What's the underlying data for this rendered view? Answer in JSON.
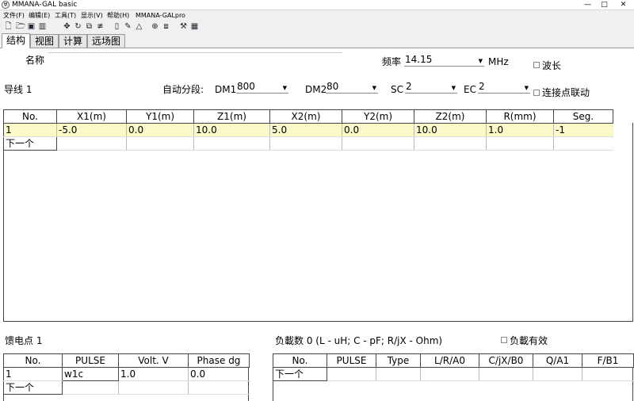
{
  "window": {
    "title": "MMANA-GAL basic",
    "minimize": "—",
    "maximize": "□",
    "close": "✕"
  },
  "menu": [
    "文件(F)",
    "编辑(E)",
    "工具(T)",
    "显示(V)",
    "帮助(H)",
    "MMANA-GALpro"
  ],
  "toolbar_icons": [
    "new-icon",
    "open-icon",
    "save-icon",
    "save-as-icon",
    "move-icon",
    "rotate-icon",
    "copy-wire-icon",
    "wire-settings-icon",
    "page-icon",
    "draw-icon",
    "triangle-icon",
    "target-icon",
    "copy-icon",
    "tools-icon",
    "calculator-icon"
  ],
  "tabs": [
    "结构",
    "视图",
    "计算",
    "远场图"
  ],
  "structure": {
    "name_label": "名称",
    "freq_label": "频率",
    "freq_value": "14.15",
    "freq_unit": "MHz",
    "wavelength_label": "波长",
    "wire_label": "导线 1",
    "auto_seg_label": "自动分段:",
    "dm1_label": "DM1",
    "dm1_value": "800",
    "dm2_label": "DM2",
    "dm2_value": "80",
    "sc_label": "SC",
    "sc_value": "2",
    "ec_label": "EC",
    "ec_value": "2",
    "link_label": "连接点联动"
  },
  "wire_table": {
    "headers": [
      "No.",
      "X1(m)",
      "Y1(m)",
      "Z1(m)",
      "X2(m)",
      "Y2(m)",
      "Z2(m)",
      "R(mm)",
      "Seg."
    ],
    "rows": [
      [
        "1",
        "-5.0",
        "0.0",
        "10.0",
        "5.0",
        "0.0",
        "10.0",
        "1.0",
        "-1"
      ]
    ],
    "next_label": "下一个"
  },
  "feed": {
    "label": "馈电点 1",
    "headers": [
      "No.",
      "PULSE",
      "Volt. V",
      "Phase dg"
    ],
    "rows": [
      [
        "1",
        "w1c",
        "1.0",
        "0.0"
      ]
    ],
    "next_label": "下一个"
  },
  "load": {
    "label": "负載数 0 (L - uH; C - pF; R/jX - Ohm)",
    "enable_label": "负載有效",
    "headers": [
      "No.",
      "PULSE",
      "Type",
      "L/R/A0",
      "C/jX/B0",
      "Q/A1",
      "F/B1"
    ],
    "next_label": "下一个"
  }
}
